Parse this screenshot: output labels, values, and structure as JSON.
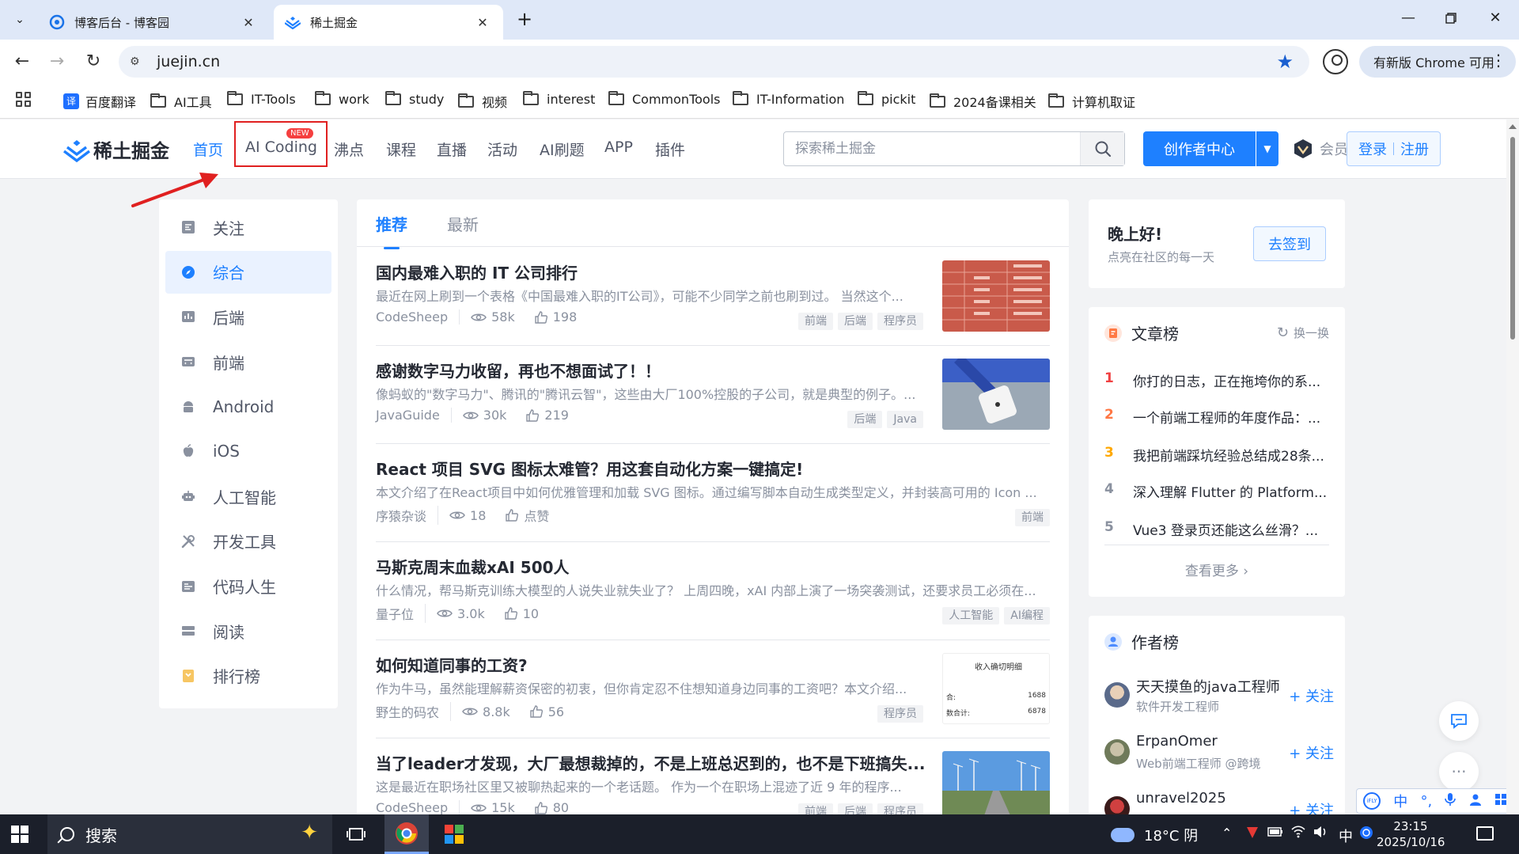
{
  "browser": {
    "tabs": [
      {
        "title": "博客后台 - 博客园",
        "active": false
      },
      {
        "title": "稀土掘金",
        "active": true
      }
    ],
    "url": "juejin.cn",
    "update_label": "有新版 Chrome 可用",
    "bookmarks": [
      "百度翻译",
      "AI工具",
      "IT-Tools",
      "work",
      "study",
      "视频",
      "interest",
      "CommonTools",
      "IT-Information",
      "pickit",
      "2024备课相关",
      "计算机取证"
    ]
  },
  "header": {
    "logo_text": "稀土掘金",
    "nav": [
      "首页",
      "AI Coding",
      "沸点",
      "课程",
      "直播",
      "活动",
      "AI刷题",
      "APP",
      "插件"
    ],
    "new_badge": "NEW",
    "search_placeholder": "探索稀土掘金",
    "creator_label": "创作者中心",
    "vip_label": "会员",
    "login_label": "登录",
    "register_label": "注册"
  },
  "sidebar": {
    "items": [
      "关注",
      "综合",
      "后端",
      "前端",
      "Android",
      "iOS",
      "人工智能",
      "开发工具",
      "代码人生",
      "阅读",
      "排行榜"
    ],
    "active_index": 1
  },
  "feed": {
    "tabs": [
      "推荐",
      "最新"
    ],
    "articles": [
      {
        "title": "国内最难入职的 IT 公司排行",
        "desc": "最近在网上刷到一个表格《中国最难入职的IT公司》，可能不少同学之前也刷到过。 当然这个...",
        "author": "CodeSheep",
        "views": "58k",
        "likes": "198",
        "tags": [
          "前端",
          "后端",
          "程序员"
        ]
      },
      {
        "title": "感谢数字马力收留，再也不想面试了！！",
        "desc": "像蚂蚁的\"数字马力\"、腾讯的\"腾讯云智\"，这些由大厂100%控股的子公司，就是典型的例子。...",
        "author": "JavaGuide",
        "views": "30k",
        "likes": "219",
        "tags": [
          "后端",
          "Java"
        ]
      },
      {
        "title": "React 项目 SVG 图标太难管？用这套自动化方案一键搞定!",
        "desc": "本文介绍了在React项目中如何优雅管理和加载 SVG 图标。通过编写脚本自动生成类型定义，并封装高可用的 Icon ...",
        "author": "序猿杂谈",
        "views": "18",
        "likes": "点赞",
        "tags": [
          "前端"
        ]
      },
      {
        "title": "马斯克周末血裁xAI 500人",
        "desc": "什么情况，帮马斯克训练大模型的人说失业就失业了？ 上周四晚，xAI 内部上演了一场突袭测试，还要求员工必须在...",
        "author": "量子位",
        "views": "3.0k",
        "likes": "10",
        "tags": [
          "人工智能",
          "AI编程"
        ]
      },
      {
        "title": "如何知道同事的工资?",
        "desc": "作为牛马，虽然能理解薪资保密的初衷，但你肯定忍不住想知道身边同事的工资吧？本文介绍...",
        "author": "野生的码农",
        "views": "8.8k",
        "likes": "56",
        "tags": [
          "程序员"
        ]
      },
      {
        "title": "当了leader才发现，大厂最想裁掉的，不是上班总迟到的，也不是下班搞失...",
        "desc": "这是最近在职场社区里又被聊热起来的一个老话题。 作为一个在职场上混迹了近 9 年的程序...",
        "author": "CodeSheep",
        "views": "15k",
        "likes": "80",
        "tags": [
          "前端",
          "后端",
          "程序员"
        ]
      }
    ],
    "thumb5_text": {
      "header": "收入确切明细",
      "row1": "1688",
      "row1_label": "合:",
      "row2": "6878",
      "row2_label": "数合计:"
    }
  },
  "greeting": {
    "title": "晚上好!",
    "subtitle": "点亮在社区的每一天",
    "checkin_label": "去签到"
  },
  "article_rank": {
    "title": "文章榜",
    "refresh_label": "换一换",
    "items": [
      {
        "rank": "1",
        "text": "你打的日志，正在拖垮你的系..."
      },
      {
        "rank": "2",
        "text": "一个前端工程师的年度作品：..."
      },
      {
        "rank": "3",
        "text": "我把前端踩坑经验总结成28条..."
      },
      {
        "rank": "4",
        "text": "深入理解 Flutter 的 Platform..."
      },
      {
        "rank": "5",
        "text": "Vue3 登录页还能这么丝滑？..."
      }
    ],
    "more_label": "查看更多 ›"
  },
  "author_rank": {
    "title": "作者榜",
    "follow_label": "+ 关注",
    "authors": [
      {
        "name": "天天摸鱼的java工程师",
        "desc": "软件开发工程师"
      },
      {
        "name": "ErpanOmer",
        "desc": "Web前端工程师 @跨境"
      },
      {
        "name": "unravel2025",
        "desc": ""
      }
    ]
  },
  "ime": {
    "items": [
      "中",
      "°,",
      "🎤"
    ]
  },
  "taskbar": {
    "search_label": "搜索",
    "weather": "18°C 阴",
    "ime_lang": "中",
    "time": "23:15",
    "date": "2025/10/16"
  },
  "colors": {
    "accent": "#1e80ff",
    "annotation_red": "#e02020"
  }
}
